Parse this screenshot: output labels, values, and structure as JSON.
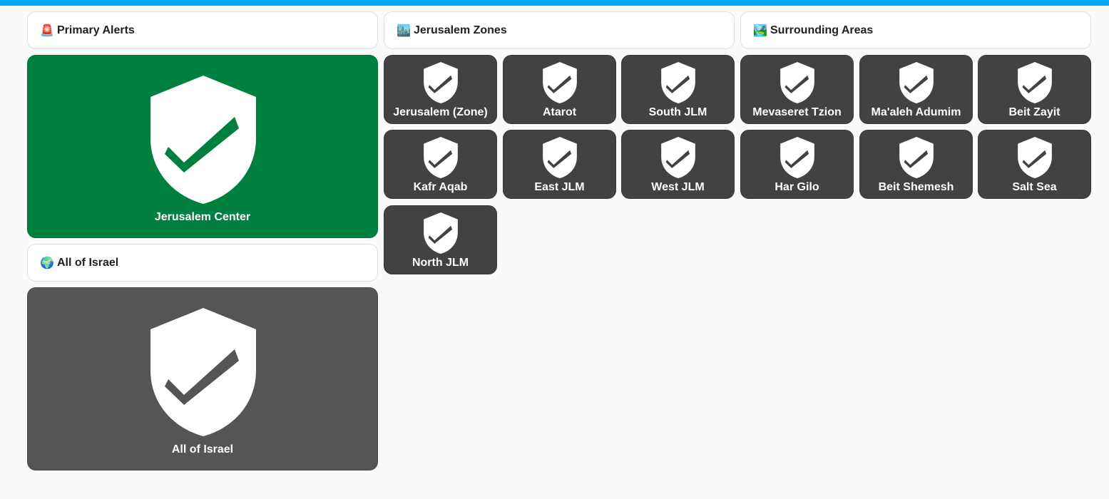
{
  "colors": {
    "top_bar": "#03a9f4",
    "ok_green": "#00803f",
    "inactive_gray": "#555555",
    "tile_dark": "#424242",
    "check_small": "#424242"
  },
  "sections": {
    "primary_alerts": {
      "icon": "🚨",
      "title": "Primary Alerts"
    },
    "jerusalem_zones": {
      "icon": "🏙️",
      "title": "Jerusalem Zones"
    },
    "surrounding_areas": {
      "icon": "🏞️",
      "title": "Surrounding Areas"
    },
    "all_of_israel": {
      "icon": "🌍",
      "title": "All of Israel"
    }
  },
  "primary_tiles": {
    "jerusalem_center": {
      "label": "Jerusalem Center",
      "icon": "shield-check-icon",
      "state": "safe"
    },
    "all_of_israel": {
      "label": "All of Israel",
      "icon": "shield-check-icon",
      "state": "inactive"
    }
  },
  "zone_tiles": [
    {
      "label": "Jerusalem (Zone)",
      "icon": "shield-check-icon"
    },
    {
      "label": "Atarot",
      "icon": "shield-check-icon"
    },
    {
      "label": "South JLM",
      "icon": "shield-check-icon"
    },
    {
      "label": "Mevaseret Tzion",
      "icon": "shield-check-icon"
    },
    {
      "label": "Ma'aleh Adumim",
      "icon": "shield-check-icon"
    },
    {
      "label": "Beit Zayit",
      "icon": "shield-check-icon"
    },
    {
      "label": "Kafr Aqab",
      "icon": "shield-check-icon"
    },
    {
      "label": "East JLM",
      "icon": "shield-check-icon"
    },
    {
      "label": "West JLM",
      "icon": "shield-check-icon"
    },
    {
      "label": "Har Gilo",
      "icon": "shield-check-icon"
    },
    {
      "label": "Beit Shemesh",
      "icon": "shield-check-icon"
    },
    {
      "label": "Salt Sea",
      "icon": "shield-check-icon"
    },
    {
      "label": "North JLM",
      "icon": "shield-check-icon"
    }
  ]
}
